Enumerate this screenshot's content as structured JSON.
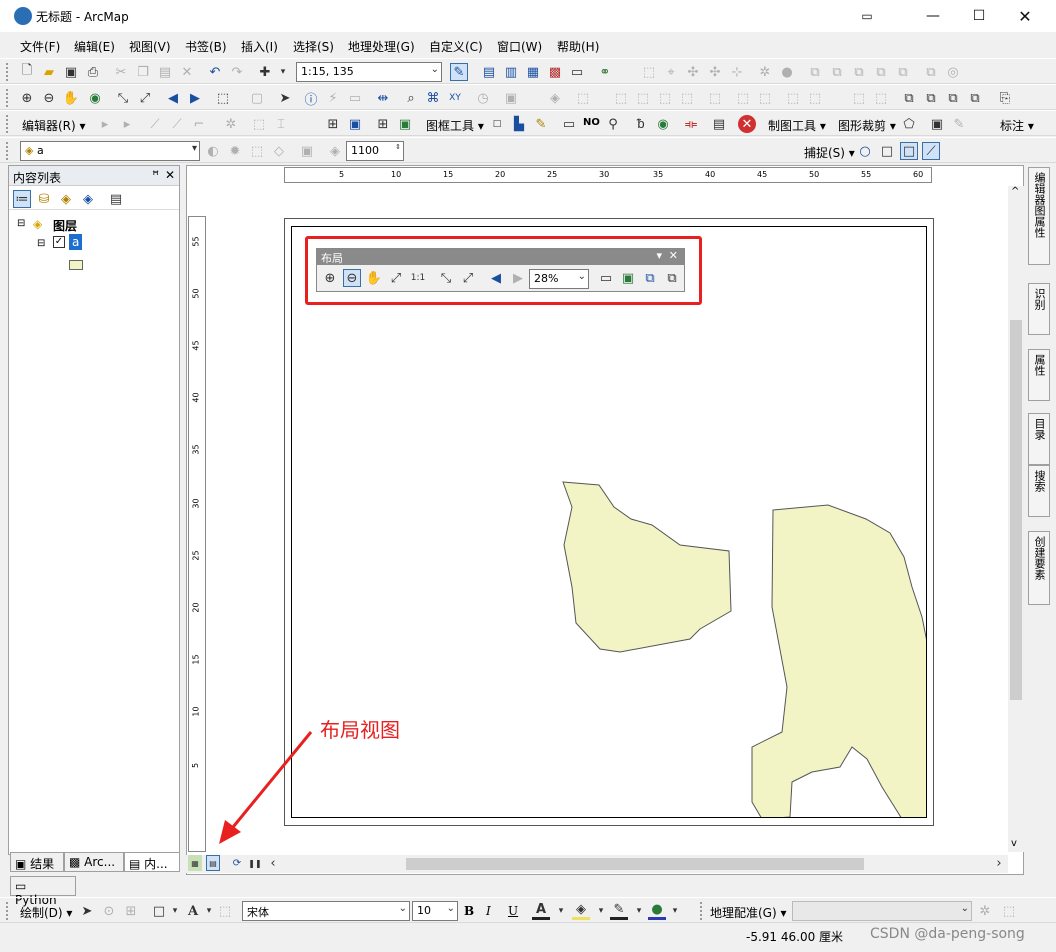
{
  "window": {
    "title": "无标题 - ArcMap",
    "controls": [
      "restore-tray",
      "minimize",
      "maximize",
      "close"
    ]
  },
  "menu": [
    "文件(F)",
    "编辑(E)",
    "视图(V)",
    "书签(B)",
    "插入(I)",
    "选择(S)",
    "地理处理(G)",
    "自定义(C)",
    "窗口(W)",
    "帮助(H)"
  ],
  "standard_toolbar": {
    "scale_value": "1:15, 135"
  },
  "editor_toolbar": {
    "editor_label": "编辑器(R)",
    "frame_tools_label": "图框工具",
    "no_label": "NO",
    "map_tools_label": "制图工具",
    "graphic_clip_label": "图形裁剪",
    "label_label": "标注"
  },
  "layer_toolbar": {
    "layer_value": "a",
    "number_value": "1100",
    "snap_label": "捕捉(S)"
  },
  "toc": {
    "title": "内容列表",
    "pin": "ᵖ",
    "close": "✕",
    "root_label": "图层",
    "layer_label": "a"
  },
  "bottom_tabs": [
    "结果",
    "Arc...",
    "内..."
  ],
  "python_tab": "Python",
  "ruler_h_ticks": [
    "5",
    "10",
    "15",
    "20",
    "25",
    "30",
    "35",
    "40",
    "45",
    "50",
    "55",
    "60"
  ],
  "ruler_v_ticks": [
    "55",
    "50",
    "45",
    "40",
    "35",
    "30",
    "25",
    "20",
    "15",
    "10",
    "5"
  ],
  "floating_toolbar": {
    "title": "布局",
    "zoom": "28%"
  },
  "annotation": "布局视图",
  "right_dock": [
    "编辑器图属性",
    "识别",
    "属性",
    "目录",
    "搜索",
    "创建要素"
  ],
  "drawing_toolbar": {
    "draw_label": "绘制(D)",
    "font_name": "宋体",
    "font_size": "10",
    "bold": "B",
    "italic": "I",
    "underline": "U",
    "georef_label": "地理配准(G)"
  },
  "status": {
    "coords": "-5.91  46.00 厘米",
    "watermark": "CSDN @da-peng-song"
  },
  "colors": {
    "polygon_fill": "#f2f4c6",
    "highlight": "#e82020",
    "accent_blue": "#2a6fb3"
  }
}
